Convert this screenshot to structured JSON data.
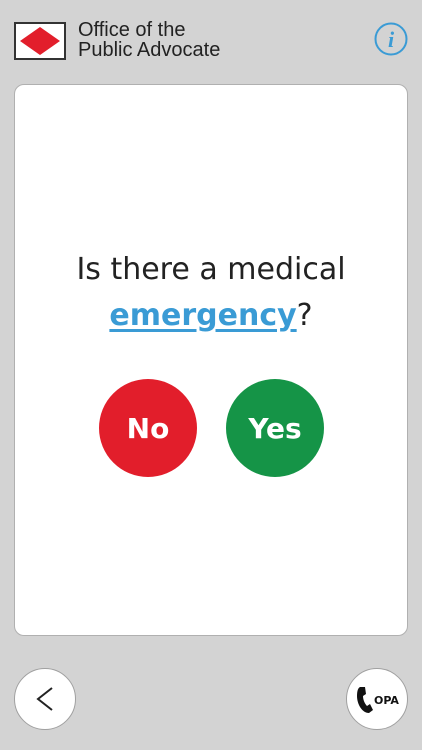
{
  "header": {
    "org_line1": "Office of the",
    "org_line2": "Public Advocate",
    "logo_icon": "opa-logo-icon",
    "info_icon": "info-icon"
  },
  "question": {
    "prefix": "Is there a medical",
    "link_text": "emergency",
    "suffix": "?"
  },
  "answers": {
    "no_label": "No",
    "yes_label": "Yes"
  },
  "footer": {
    "back_icon": "chevron-left-icon",
    "call_label": "OPA",
    "call_icon": "phone-icon"
  },
  "colors": {
    "background": "#d3d3d3",
    "no": "#e21e2b",
    "yes": "#159447",
    "link": "#3a9bd5",
    "info": "#3a9bd5",
    "logo_red": "#e21e2b"
  }
}
